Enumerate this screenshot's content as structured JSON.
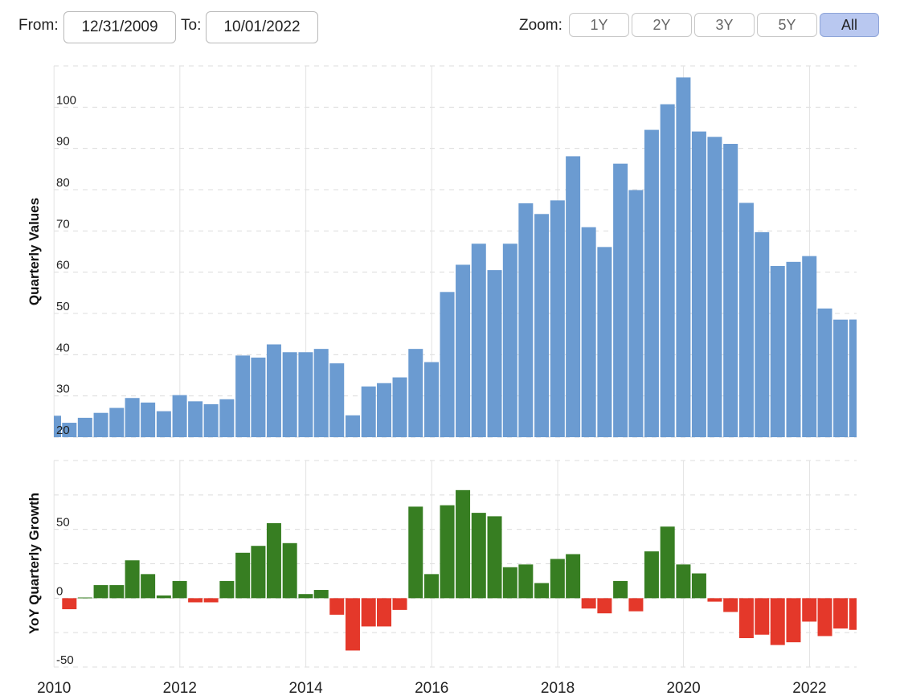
{
  "controls": {
    "from_label": "From:",
    "from_value": "12/31/2009",
    "to_label": "To:",
    "to_value": "10/01/2022",
    "zoom_label": "Zoom:",
    "zoom_options": [
      "1Y",
      "2Y",
      "3Y",
      "5Y",
      "All"
    ],
    "zoom_selected": "All"
  },
  "chart_data": [
    {
      "type": "bar",
      "ylabel": "Quarterly Values",
      "color": "#6b9bd1",
      "ylim": [
        20,
        110
      ],
      "yticks": [
        20,
        30,
        40,
        50,
        60,
        70,
        80,
        90,
        100
      ],
      "grid": true,
      "x": [
        "2009-12-31",
        "2010-03-31",
        "2010-06-30",
        "2010-09-30",
        "2010-12-31",
        "2011-03-31",
        "2011-06-30",
        "2011-09-30",
        "2011-12-31",
        "2012-03-31",
        "2012-06-30",
        "2012-09-30",
        "2012-12-31",
        "2013-03-31",
        "2013-06-30",
        "2013-09-30",
        "2013-12-31",
        "2014-03-31",
        "2014-06-30",
        "2014-09-30",
        "2014-12-31",
        "2015-03-31",
        "2015-06-30",
        "2015-09-30",
        "2015-12-31",
        "2016-03-31",
        "2016-06-30",
        "2016-09-30",
        "2016-12-31",
        "2017-03-31",
        "2017-06-30",
        "2017-09-30",
        "2017-12-31",
        "2018-03-31",
        "2018-06-30",
        "2018-09-30",
        "2018-12-31",
        "2019-03-31",
        "2019-06-30",
        "2019-09-30",
        "2019-12-31",
        "2020-03-31",
        "2020-06-30",
        "2020-09-30",
        "2020-12-31",
        "2021-03-31",
        "2021-06-30",
        "2021-09-30",
        "2021-12-31",
        "2022-03-31",
        "2022-06-30",
        "2022-09-30",
        "2022-10-01"
      ],
      "values": [
        25.2,
        23.5,
        24.7,
        25.9,
        27.1,
        29.5,
        28.4,
        26.3,
        30.2,
        28.7,
        28.0,
        29.2,
        39.8,
        39.3,
        42.5,
        40.6,
        40.6,
        41.4,
        37.9,
        25.3,
        32.3,
        33.1,
        34.5,
        41.4,
        38.2,
        55.2,
        61.8,
        66.9,
        60.5,
        66.9,
        76.7,
        74.1,
        77.4,
        88.1,
        70.9,
        66.1,
        86.3,
        79.9,
        94.5,
        100.7,
        107.2,
        94.1,
        92.8,
        91.1,
        76.8,
        69.7,
        61.5,
        62.5,
        63.9,
        51.2,
        48.5,
        48.5,
        48.5
      ]
    },
    {
      "type": "bar",
      "ylabel": "YoY Quarterly Growth",
      "positive_color": "#377e22",
      "negative_color": "#e4382a",
      "ylim": [
        -50,
        100
      ],
      "yticks": [
        -50,
        0,
        50
      ],
      "grid": true,
      "x": [
        "2009-12-31",
        "2010-03-31",
        "2010-06-30",
        "2010-09-30",
        "2010-12-31",
        "2011-03-31",
        "2011-06-30",
        "2011-09-30",
        "2011-12-31",
        "2012-03-31",
        "2012-06-30",
        "2012-09-30",
        "2012-12-31",
        "2013-03-31",
        "2013-06-30",
        "2013-09-30",
        "2013-12-31",
        "2014-03-31",
        "2014-06-30",
        "2014-09-30",
        "2014-12-31",
        "2015-03-31",
        "2015-06-30",
        "2015-09-30",
        "2015-12-31",
        "2016-03-31",
        "2016-06-30",
        "2016-09-30",
        "2016-12-31",
        "2017-03-31",
        "2017-06-30",
        "2017-09-30",
        "2017-12-31",
        "2018-03-31",
        "2018-06-30",
        "2018-09-30",
        "2018-12-31",
        "2019-03-31",
        "2019-06-30",
        "2019-09-30",
        "2019-12-31",
        "2020-03-31",
        "2020-06-30",
        "2020-09-30",
        "2020-12-31",
        "2021-03-31",
        "2021-06-30",
        "2021-09-30",
        "2021-12-31",
        "2022-03-31",
        "2022-06-30",
        "2022-09-30",
        "2022-10-01"
      ],
      "values": [
        null,
        -8,
        0.5,
        9.5,
        9.5,
        27.5,
        17.5,
        2,
        12.5,
        -3,
        -3,
        12.5,
        33,
        38,
        54.5,
        40,
        3,
        6,
        -12,
        -38,
        -20.5,
        -20.5,
        -8.5,
        66.5,
        17.5,
        67.5,
        78.5,
        62,
        59.5,
        22.5,
        24.5,
        11,
        28.5,
        32,
        -7.5,
        -11,
        12.5,
        -9.5,
        34,
        52,
        24.5,
        18,
        -2.5,
        -10,
        -29,
        -26.5,
        -34,
        -32,
        -17,
        -27.5,
        -22,
        -23,
        null
      ]
    }
  ],
  "x_axis": {
    "ticks": [
      "2010",
      "2012",
      "2014",
      "2016",
      "2018",
      "2020",
      "2022"
    ],
    "range": [
      "2009-12-31",
      "2022-10-01"
    ]
  }
}
